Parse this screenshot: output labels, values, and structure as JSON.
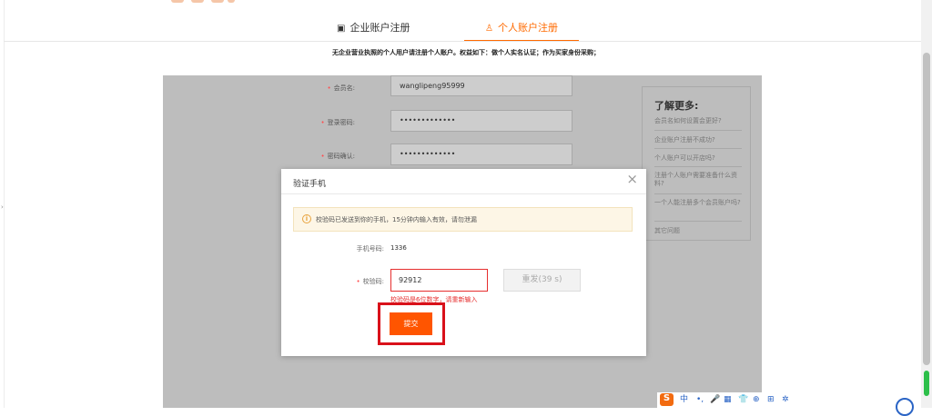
{
  "tabs": {
    "business": {
      "icon": "building-icon",
      "label": "企业账户注册"
    },
    "personal": {
      "icon": "user-icon",
      "label": "个人账户注册",
      "active": true
    }
  },
  "notice": "无企业营业执照的个人用户请注册个人账户。权益如下：做个人实名认证；作为买家身份采购；",
  "form": {
    "member_label": "会员名:",
    "member_value": "wanglipeng95999",
    "password_label": "登录密码:",
    "password_value": "•••••••••••••",
    "confirm_label": "密码确认:",
    "confirm_value": "•••••••••••••"
  },
  "sidebar": {
    "title": "了解更多:",
    "links": [
      "会员名如何设置会更好?",
      "企业账户注册不成功?",
      "个人账户可以开店吗?",
      "注册个人账户需要准备什么资料?",
      "一个人能注册多个会员账户吗?",
      "其它问题"
    ]
  },
  "modal": {
    "title": "验证手机",
    "close": "×",
    "alert": "校验码已发送到你的手机，15分钟内输入有效，请勿泄漏",
    "phone_label": "手机号码:",
    "phone_value": "1336",
    "code_label": "校验码:",
    "code_value": "92912",
    "resend_label": "重发(39 s)",
    "error": "校验码是6位数字，请重新输入",
    "submit_label": "提交"
  },
  "ime": {
    "logo": "S",
    "lang": "中",
    "items": [
      "•,",
      "🎤",
      "▦",
      "👕",
      "⊕",
      "⊞",
      "✲"
    ]
  },
  "colors": {
    "accent": "#ff6a00",
    "submit": "#ff5500",
    "error": "#e62e2e",
    "highlight": "#d9111a"
  }
}
